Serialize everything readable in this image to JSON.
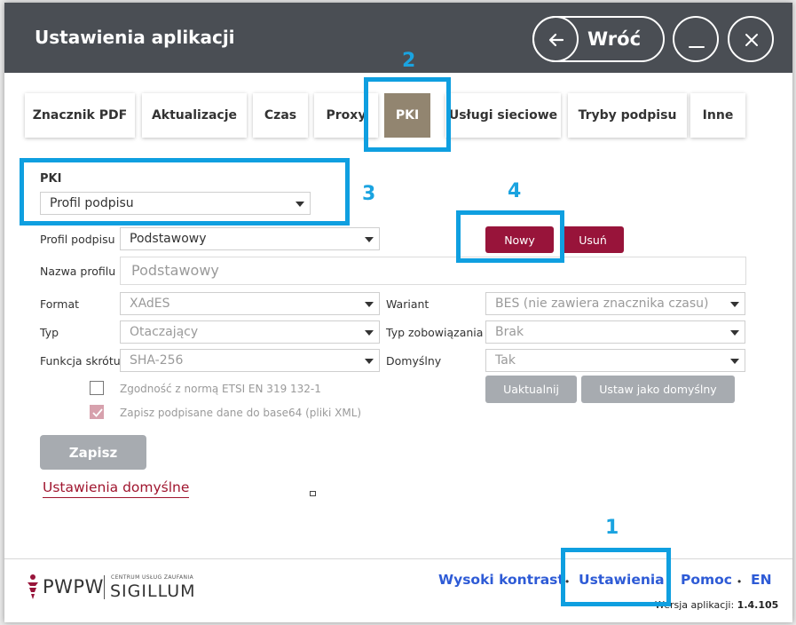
{
  "window": {
    "title": "Ustawienia aplikacji",
    "back_label": "Wróć"
  },
  "annotations": [
    "1",
    "2",
    "3",
    "4"
  ],
  "tabs": [
    {
      "label": "Znacznik PDF"
    },
    {
      "label": "Aktualizacje"
    },
    {
      "label": "Czas"
    },
    {
      "label": "Proxy"
    },
    {
      "label": "PKI",
      "active": true
    },
    {
      "label": "Usługi sieciowe"
    },
    {
      "label": "Tryby podpisu"
    },
    {
      "label": "Inne"
    }
  ],
  "pki": {
    "heading": "PKI",
    "section_select": "Profil podpisu",
    "profile_label": "Profil podpisu",
    "profile_value": "Podstawowy",
    "new_button": "Nowy",
    "delete_button": "Usuń",
    "name_label": "Nazwa profilu",
    "name_value": "Podstawowy",
    "format_label": "Format",
    "format_value": "XAdES",
    "variant_label": "Wariant",
    "variant_value": "BES (nie zawiera znacznika czasu)",
    "type_label": "Typ",
    "type_value": "Otaczający",
    "commitment_label": "Typ zobowiązania",
    "commitment_value": "Brak",
    "hash_label": "Funkcja skrótu",
    "hash_value": "SHA-256",
    "default_label": "Domyślny",
    "default_value": "Tak",
    "update_button": "Uaktualnij",
    "set_default_button": "Ustaw jako domyślny",
    "etsi_checkbox": {
      "label": "Zgodność z normą ETSI EN 319 132-1",
      "checked": false
    },
    "base64_checkbox": {
      "label": "Zapisz podpisane dane do base64 (pliki XML)",
      "checked": true
    }
  },
  "actions": {
    "save": "Zapisz",
    "defaults_link": "Ustawienia domyślne"
  },
  "footer": {
    "high_contrast": "Wysoki kontrast",
    "settings": "Ustawienia",
    "help": "Pomoc",
    "language": "EN",
    "version_label": "Wersja aplikacji:",
    "version_value": "1.4.105",
    "logo_main": "PWPW",
    "logo_sub": "CENTRUM USŁUG ZAUFANIA",
    "logo_brand": "SIGILLUM"
  },
  "colors": {
    "titlebar": "#4a4e54",
    "accent_red": "#98143a",
    "tab_active": "#928570",
    "link_blue": "#2e5bd6",
    "annotation_blue": "#0f9fe0"
  }
}
